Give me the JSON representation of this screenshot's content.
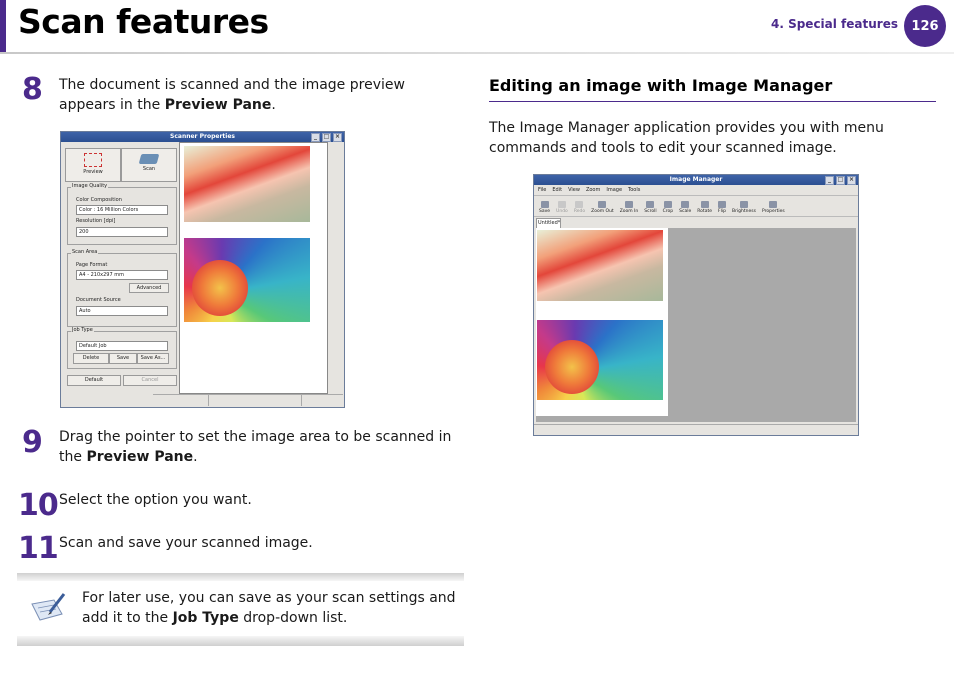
{
  "header": {
    "title": "Scan features",
    "chapter": "4.  Special features",
    "page_number": "126"
  },
  "steps": [
    {
      "num": "8",
      "text_before": "The document is scanned and the image preview appears in the ",
      "bold": "Preview Pane",
      "text_after": "."
    },
    {
      "num": "9",
      "text_before": "Drag the pointer to set the image area to be scanned in the ",
      "bold": "Preview Pane",
      "text_after": "."
    },
    {
      "num": "10",
      "text": "Select the option you want."
    },
    {
      "num": "11",
      "text": "Scan and save your scanned image."
    }
  ],
  "note": {
    "text_before": "For later use, you can save as your scan settings and add it to the ",
    "bold": "Job Type",
    "text_after": " drop-down list."
  },
  "section": {
    "heading": "Editing an image with Image Manager",
    "body": "The Image Manager application provides you with menu commands and tools to edit your scanned image."
  },
  "scanner_window": {
    "title": "Scanner Properties",
    "preview_button": "Preview",
    "scan_button": "Scan",
    "image_quality_group": "Image Quality",
    "color_label": "Color Composition",
    "color_value": "Color : 16 Million Colors",
    "resolution_label": "Resolution [dpi]",
    "resolution_value": "200",
    "scan_area_group": "Scan Area",
    "page_format_label": "Page Format",
    "page_format_value": "A4 - 210x297 mm",
    "advanced_button": "Advanced",
    "doc_source_label": "Document Source",
    "doc_source_value": "Auto",
    "job_type_group": "Job Type",
    "job_value": "Default Job",
    "delete_button": "Delete",
    "save_button": "Save",
    "save_as_button": "Save As...",
    "default_button": "Default",
    "cancel_button": "Cancel"
  },
  "image_manager_window": {
    "title": "Image Manager",
    "menu": [
      "File",
      "Edit",
      "View",
      "Zoom",
      "Image",
      "Tools"
    ],
    "toolbar": [
      "Save",
      "Undo",
      "Redo",
      "Zoom Out",
      "Zoom In",
      "Scroll",
      "Crop",
      "Scale",
      "Rotate",
      "Flip",
      "Brightness",
      "Properties"
    ],
    "tab": "Untitled*"
  }
}
